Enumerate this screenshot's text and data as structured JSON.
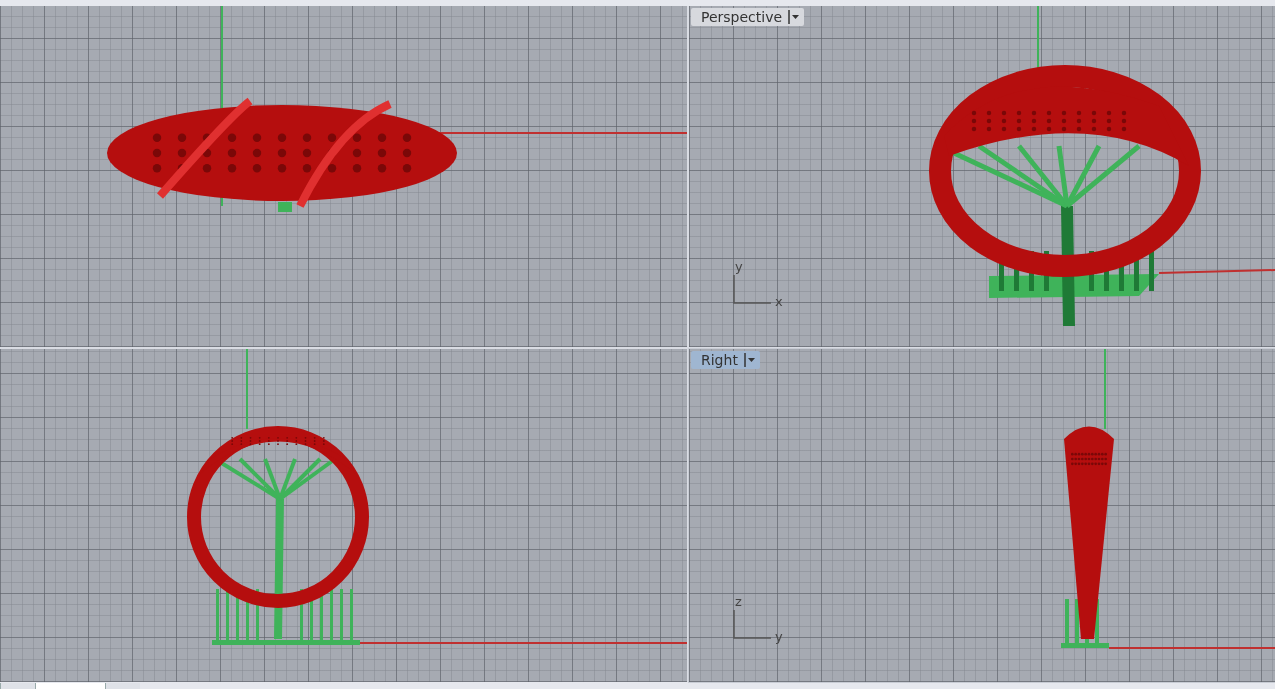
{
  "viewports": [
    {
      "kind": "top",
      "active": false
    },
    {
      "kind": "perspective",
      "active": false,
      "label": "Perspective",
      "axes": [
        "y",
        "x"
      ]
    },
    {
      "kind": "front",
      "active": false
    },
    {
      "kind": "right",
      "active": true,
      "label": "Right",
      "axes": [
        "z",
        "y"
      ]
    }
  ],
  "bottom_tabs": [
    {
      "selected": false
    },
    {
      "selected": true
    },
    {
      "selected": false
    }
  ]
}
